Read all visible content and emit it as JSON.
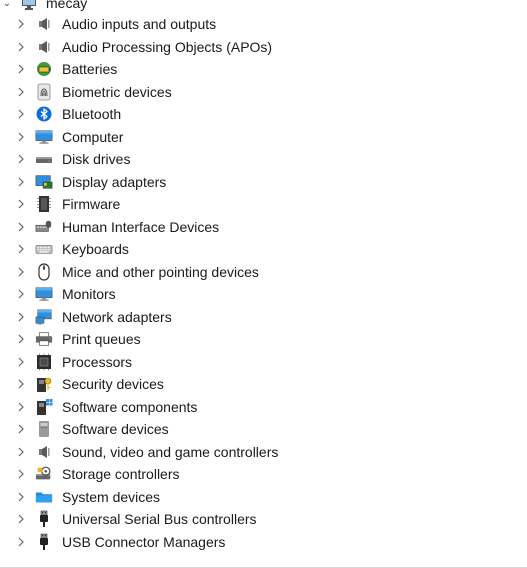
{
  "root": {
    "label": "mecay",
    "icon": "computer-root-icon"
  },
  "items": [
    {
      "label": "Audio inputs and outputs",
      "icon": "speaker-icon",
      "name": "audio-inputs-outputs"
    },
    {
      "label": "Audio Processing Objects (APOs)",
      "icon": "speaker-icon",
      "name": "audio-processing-objects"
    },
    {
      "label": "Batteries",
      "icon": "battery-icon",
      "name": "batteries"
    },
    {
      "label": "Biometric devices",
      "icon": "fingerprint-icon",
      "name": "biometric-devices"
    },
    {
      "label": "Bluetooth",
      "icon": "bluetooth-icon",
      "name": "bluetooth"
    },
    {
      "label": "Computer",
      "icon": "monitor-icon",
      "name": "computer"
    },
    {
      "label": "Disk drives",
      "icon": "disk-drive-icon",
      "name": "disk-drives"
    },
    {
      "label": "Display adapters",
      "icon": "display-adapter-icon",
      "name": "display-adapters"
    },
    {
      "label": "Firmware",
      "icon": "firmware-icon",
      "name": "firmware"
    },
    {
      "label": "Human Interface Devices",
      "icon": "hid-icon",
      "name": "human-interface-devices"
    },
    {
      "label": "Keyboards",
      "icon": "keyboard-icon",
      "name": "keyboards"
    },
    {
      "label": "Mice and other pointing devices",
      "icon": "mouse-icon",
      "name": "mice"
    },
    {
      "label": "Monitors",
      "icon": "monitor-icon",
      "name": "monitors"
    },
    {
      "label": "Network adapters",
      "icon": "network-icon",
      "name": "network-adapters"
    },
    {
      "label": "Print queues",
      "icon": "printer-icon",
      "name": "print-queues"
    },
    {
      "label": "Processors",
      "icon": "processor-icon",
      "name": "processors"
    },
    {
      "label": "Security devices",
      "icon": "security-icon",
      "name": "security-devices"
    },
    {
      "label": "Software components",
      "icon": "software-component-icon",
      "name": "software-components"
    },
    {
      "label": "Software devices",
      "icon": "software-device-icon",
      "name": "software-devices"
    },
    {
      "label": "Sound, video and game controllers",
      "icon": "speaker-icon",
      "name": "sound-video-game"
    },
    {
      "label": "Storage controllers",
      "icon": "storage-controller-icon",
      "name": "storage-controllers"
    },
    {
      "label": "System devices",
      "icon": "folder-icon",
      "name": "system-devices"
    },
    {
      "label": "Universal Serial Bus controllers",
      "icon": "usb-icon",
      "name": "usb-controllers"
    },
    {
      "label": "USB Connector Managers",
      "icon": "usb-icon",
      "name": "usb-connector-managers"
    }
  ],
  "colors": {
    "text": "#1a1a1a",
    "chevron": "#666666",
    "bluetooth": "#0a6fd8",
    "monitor": "#2f8fe0"
  }
}
